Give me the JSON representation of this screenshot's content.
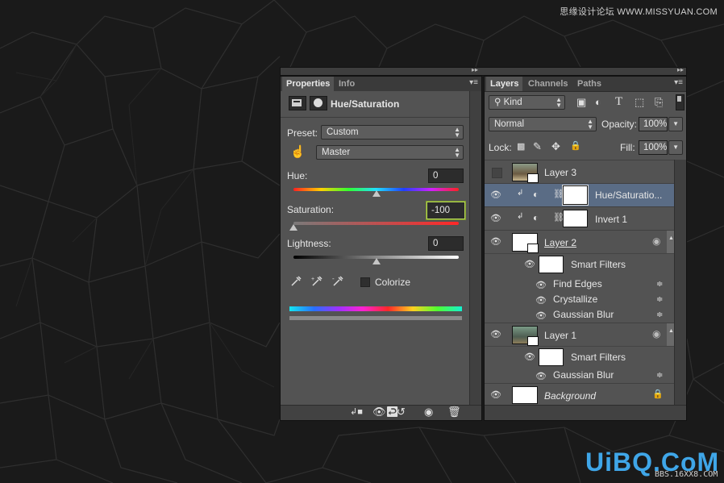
{
  "watermark": {
    "top_text": "思缘设计论坛 WWW.MISSYUAN.COM",
    "logo": "UiBQ.CoM",
    "sub": "BBS.16XX8.COM"
  },
  "properties_panel": {
    "tabs": [
      "Properties",
      "Info"
    ],
    "title": "Hue/Saturation",
    "preset_label": "Preset:",
    "preset_value": "Custom",
    "channel_value": "Master",
    "hue_label": "Hue:",
    "hue_value": "0",
    "hue_level": 0.5,
    "saturation_label": "Saturation:",
    "saturation_value": "-100",
    "saturation_level": 0.0,
    "lightness_label": "Lightness:",
    "lightness_value": "0",
    "lightness_level": 0.5,
    "colorize_label": "Colorize",
    "colorize_checked": false
  },
  "layers_panel": {
    "tabs": [
      "Layers",
      "Channels",
      "Paths"
    ],
    "filter_value": "Kind",
    "blend_mode": "Normal",
    "opacity_label": "Opacity:",
    "opacity_value": "100%",
    "lock_label": "Lock:",
    "fill_label": "Fill:",
    "fill_value": "100%",
    "layers": [
      {
        "name": "Layer 3",
        "visible": false
      },
      {
        "name": "Hue/Saturatio...",
        "visible": true,
        "selected": true
      },
      {
        "name": "Invert 1",
        "visible": true
      },
      {
        "name": "Layer 2",
        "visible": true
      },
      {
        "name": "Smart Filters",
        "visible": true
      },
      {
        "name": "Find Edges",
        "visible": true
      },
      {
        "name": "Crystallize",
        "visible": true
      },
      {
        "name": "Gaussian Blur",
        "visible": true
      },
      {
        "name": "Layer 1",
        "visible": true
      },
      {
        "name": "Smart Filters",
        "visible": true
      },
      {
        "name": "Gaussian Blur",
        "visible": true
      },
      {
        "name": "Background",
        "visible": true
      }
    ]
  },
  "colors": {
    "panel": "#535353",
    "selected_row": "#5a6c85",
    "focus_border": "#b7d85a"
  }
}
